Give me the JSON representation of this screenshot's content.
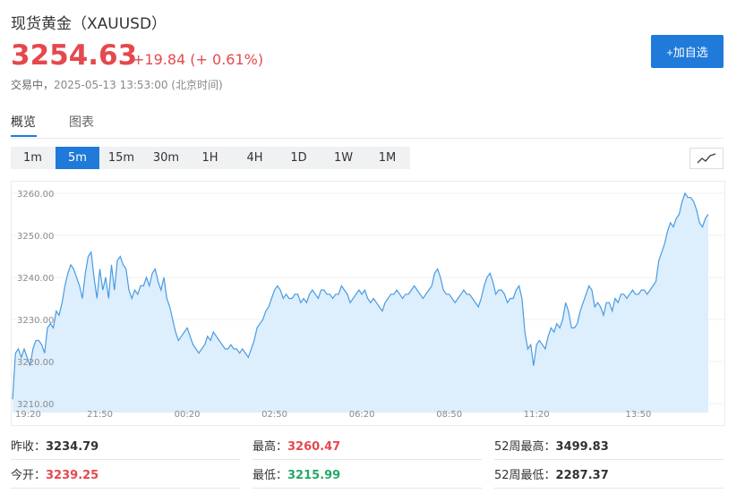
{
  "header": {
    "title": "现货黄金（XAUUSD）",
    "price": "3254.63",
    "change": "+19.84 (+ 0.61%)",
    "status": "交易中，",
    "timestamp": "2025-05-13 13:53:00 (北京时间)",
    "add_button": "+加自选"
  },
  "tabs": [
    {
      "label": "概览",
      "active": true
    },
    {
      "label": "图表",
      "active": false
    }
  ],
  "periods": [
    {
      "label": "1m",
      "active": false
    },
    {
      "label": "5m",
      "active": true
    },
    {
      "label": "15m",
      "active": false
    },
    {
      "label": "30m",
      "active": false
    },
    {
      "label": "1H",
      "active": false
    },
    {
      "label": "4H",
      "active": false
    },
    {
      "label": "1D",
      "active": false
    },
    {
      "label": "1W",
      "active": false
    },
    {
      "label": "1M",
      "active": false
    }
  ],
  "chart_type_icon": "line-chart-icon",
  "colors": {
    "accent": "#1f7ad9",
    "up": "#e5484d",
    "down": "#26a86b",
    "line": "#4a9be3",
    "fill": "#ddeefc"
  },
  "chart_data": {
    "type": "area",
    "ylim": [
      3208,
      3264
    ],
    "y_ticks": [
      3210,
      3220,
      3230,
      3240,
      3250,
      3260
    ],
    "y_tick_labels": [
      "3210.00",
      "3220.00",
      "3230.00",
      "3240.00",
      "3250.00",
      "3260.00"
    ],
    "x_tick_labels": [
      "19:20",
      "21:50",
      "00:20",
      "02:50",
      "06:20",
      "08:50",
      "11:20",
      "13:50"
    ],
    "x_tick_index": [
      0,
      30,
      60,
      90,
      120,
      150,
      180,
      215
    ],
    "grid": true,
    "values": [
      3211,
      3222,
      3223,
      3221,
      3223,
      3221,
      3219,
      3223,
      3225,
      3225,
      3224,
      3222,
      3228,
      3229,
      3228,
      3232,
      3231,
      3234,
      3238,
      3241,
      3243,
      3242,
      3240,
      3238,
      3235,
      3241,
      3245,
      3246,
      3240,
      3235,
      3242,
      3237,
      3240,
      3235,
      3243,
      3237,
      3244,
      3245,
      3243,
      3242,
      3237,
      3235,
      3237,
      3236,
      3238,
      3238,
      3240,
      3238,
      3241,
      3242,
      3239,
      3237,
      3240,
      3235,
      3233,
      3230,
      3227,
      3225,
      3226,
      3227,
      3228,
      3226,
      3224,
      3223,
      3222,
      3223,
      3224,
      3226,
      3225,
      3227,
      3226,
      3225,
      3224,
      3223,
      3223,
      3224,
      3223,
      3223,
      3222,
      3223,
      3222,
      3221,
      3223,
      3225,
      3228,
      3229,
      3230,
      3232,
      3233,
      3235,
      3237,
      3238,
      3237,
      3235,
      3236,
      3235,
      3235,
      3236,
      3236,
      3234,
      3235,
      3234,
      3236,
      3237,
      3236,
      3235,
      3237,
      3237,
      3236,
      3236,
      3235,
      3236,
      3236,
      3238,
      3237,
      3236,
      3234,
      3235,
      3236,
      3237,
      3236,
      3237,
      3235,
      3234,
      3235,
      3234,
      3233,
      3232,
      3234,
      3235,
      3236,
      3236,
      3237,
      3236,
      3235,
      3236,
      3236,
      3237,
      3238,
      3237,
      3236,
      3235,
      3236,
      3237,
      3238,
      3241,
      3242,
      3240,
      3237,
      3236,
      3236,
      3235,
      3234,
      3235,
      3236,
      3237,
      3236,
      3236,
      3235,
      3234,
      3233,
      3235,
      3238,
      3240,
      3241,
      3239,
      3236,
      3237,
      3237,
      3236,
      3234,
      3235,
      3235,
      3237,
      3238,
      3235,
      3227,
      3223,
      3224,
      3219,
      3224,
      3225,
      3224,
      3223,
      3226,
      3228,
      3227,
      3229,
      3228,
      3230,
      3234,
      3232,
      3228,
      3228,
      3229,
      3232,
      3234,
      3236,
      3238,
      3237,
      3233,
      3234,
      3233,
      3231,
      3234,
      3234,
      3232,
      3235,
      3234,
      3236,
      3236,
      3235,
      3236,
      3237,
      3236,
      3236,
      3237,
      3237,
      3236,
      3237,
      3238,
      3239,
      3244,
      3246,
      3248,
      3251,
      3253,
      3252,
      3254,
      3255,
      3258,
      3260,
      3259,
      3259,
      3258,
      3256,
      3253,
      3252,
      3254,
      3255
    ]
  },
  "stats": [
    {
      "label": "昨收：",
      "value": "3234.79",
      "color": "#333333"
    },
    {
      "label": "最高：",
      "value": "3260.47",
      "color": "#e5484d"
    },
    {
      "label": "52周最高：",
      "value": "3499.83",
      "color": "#333333"
    },
    {
      "label": "今开：",
      "value": "3239.25",
      "color": "#e5484d"
    },
    {
      "label": "最低：",
      "value": "3215.99",
      "color": "#26a86b"
    },
    {
      "label": "52周最低：",
      "value": "2287.37",
      "color": "#333333"
    }
  ]
}
